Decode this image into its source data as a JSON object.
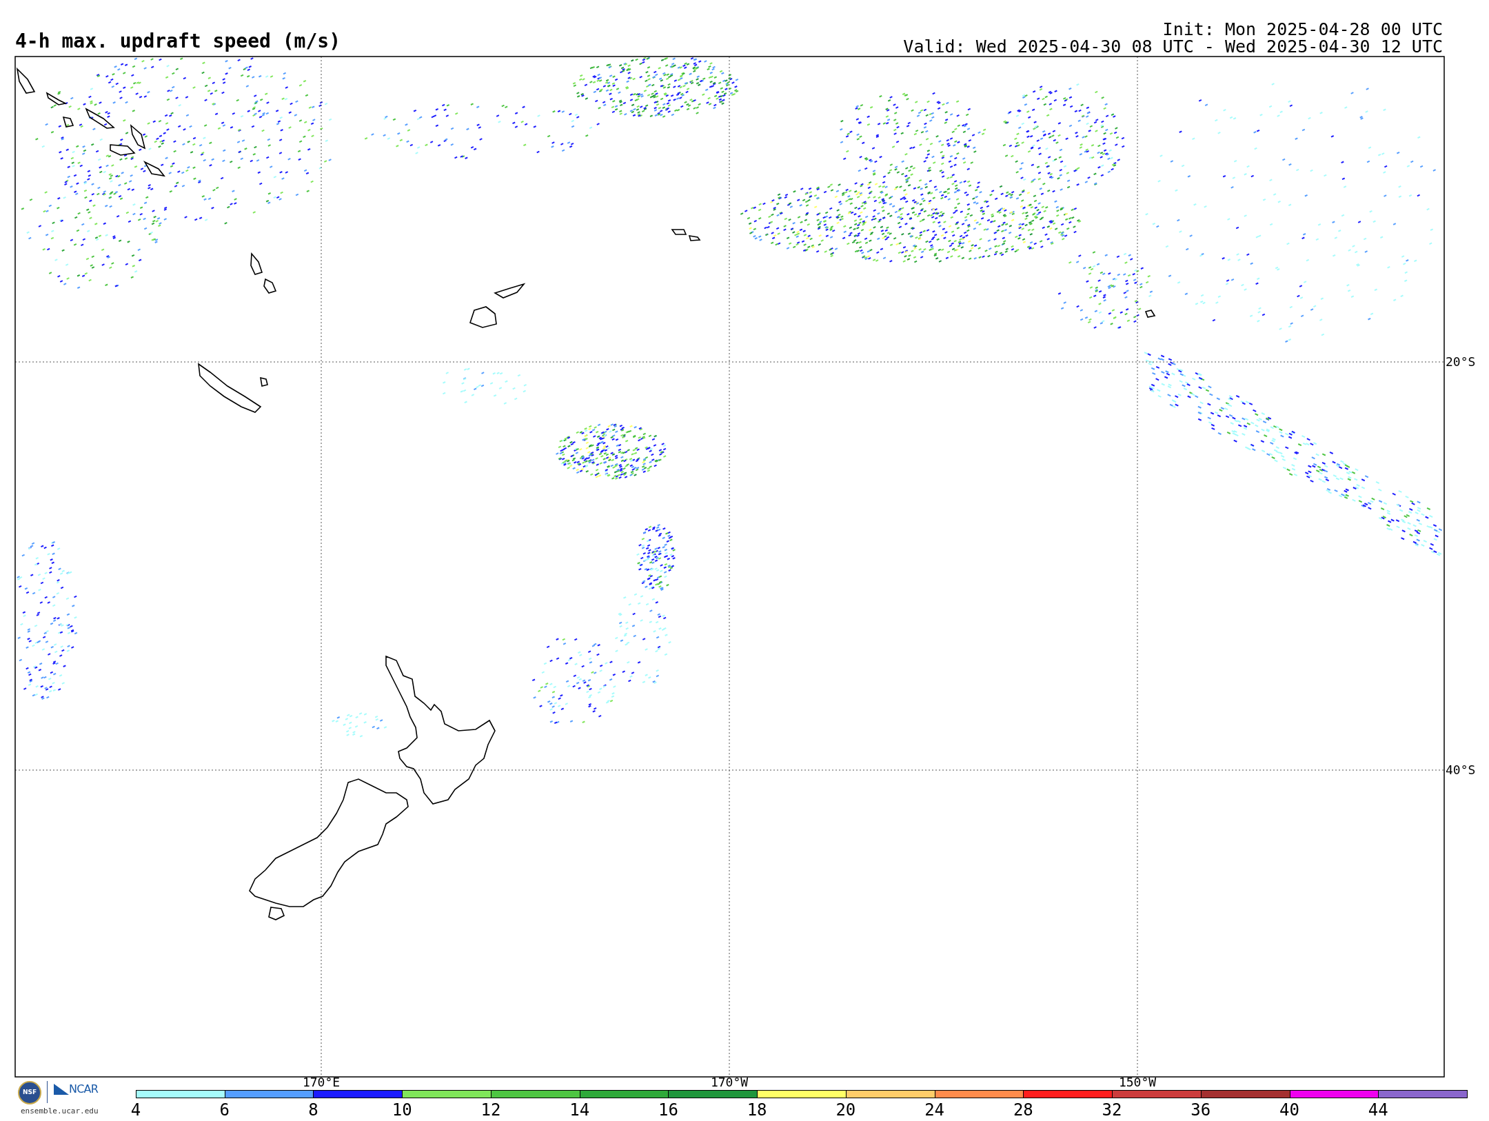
{
  "title": "4-h max. updraft speed (m/s)",
  "init": "Init: Mon 2025-04-28 00 UTC",
  "valid": "Valid: Wed 2025-04-30 08 UTC - Wed 2025-04-30 12 UTC",
  "map": {
    "lat_labels": [
      "20°S",
      "40°S"
    ],
    "lon_labels": [
      "170°E",
      "170°W",
      "150°W"
    ]
  },
  "colorbar": [
    {
      "label": "4",
      "color": "#a6fcfc"
    },
    {
      "label": "6",
      "color": "#559eff"
    },
    {
      "label": "8",
      "color": "#1c1cff"
    },
    {
      "label": "10",
      "color": "#80e65a"
    },
    {
      "label": "12",
      "color": "#4ec542"
    },
    {
      "label": "14",
      "color": "#2fa93a"
    },
    {
      "label": "16",
      "color": "#1f963c"
    },
    {
      "label": "18",
      "color": "#ffff66"
    },
    {
      "label": "20",
      "color": "#ffcd6a"
    },
    {
      "label": "24",
      "color": "#ff8c4c"
    },
    {
      "label": "28",
      "color": "#ff1e1e"
    },
    {
      "label": "32",
      "color": "#cc3c3c"
    },
    {
      "label": "36",
      "color": "#a43030"
    },
    {
      "label": "40",
      "color": "#ef00ef"
    },
    {
      "label": "44",
      "color": "#8a66cc"
    }
  ],
  "logo": {
    "nsf": "NSF",
    "ncar": "NCAR",
    "url": "ensemble.ucar.edu"
  }
}
